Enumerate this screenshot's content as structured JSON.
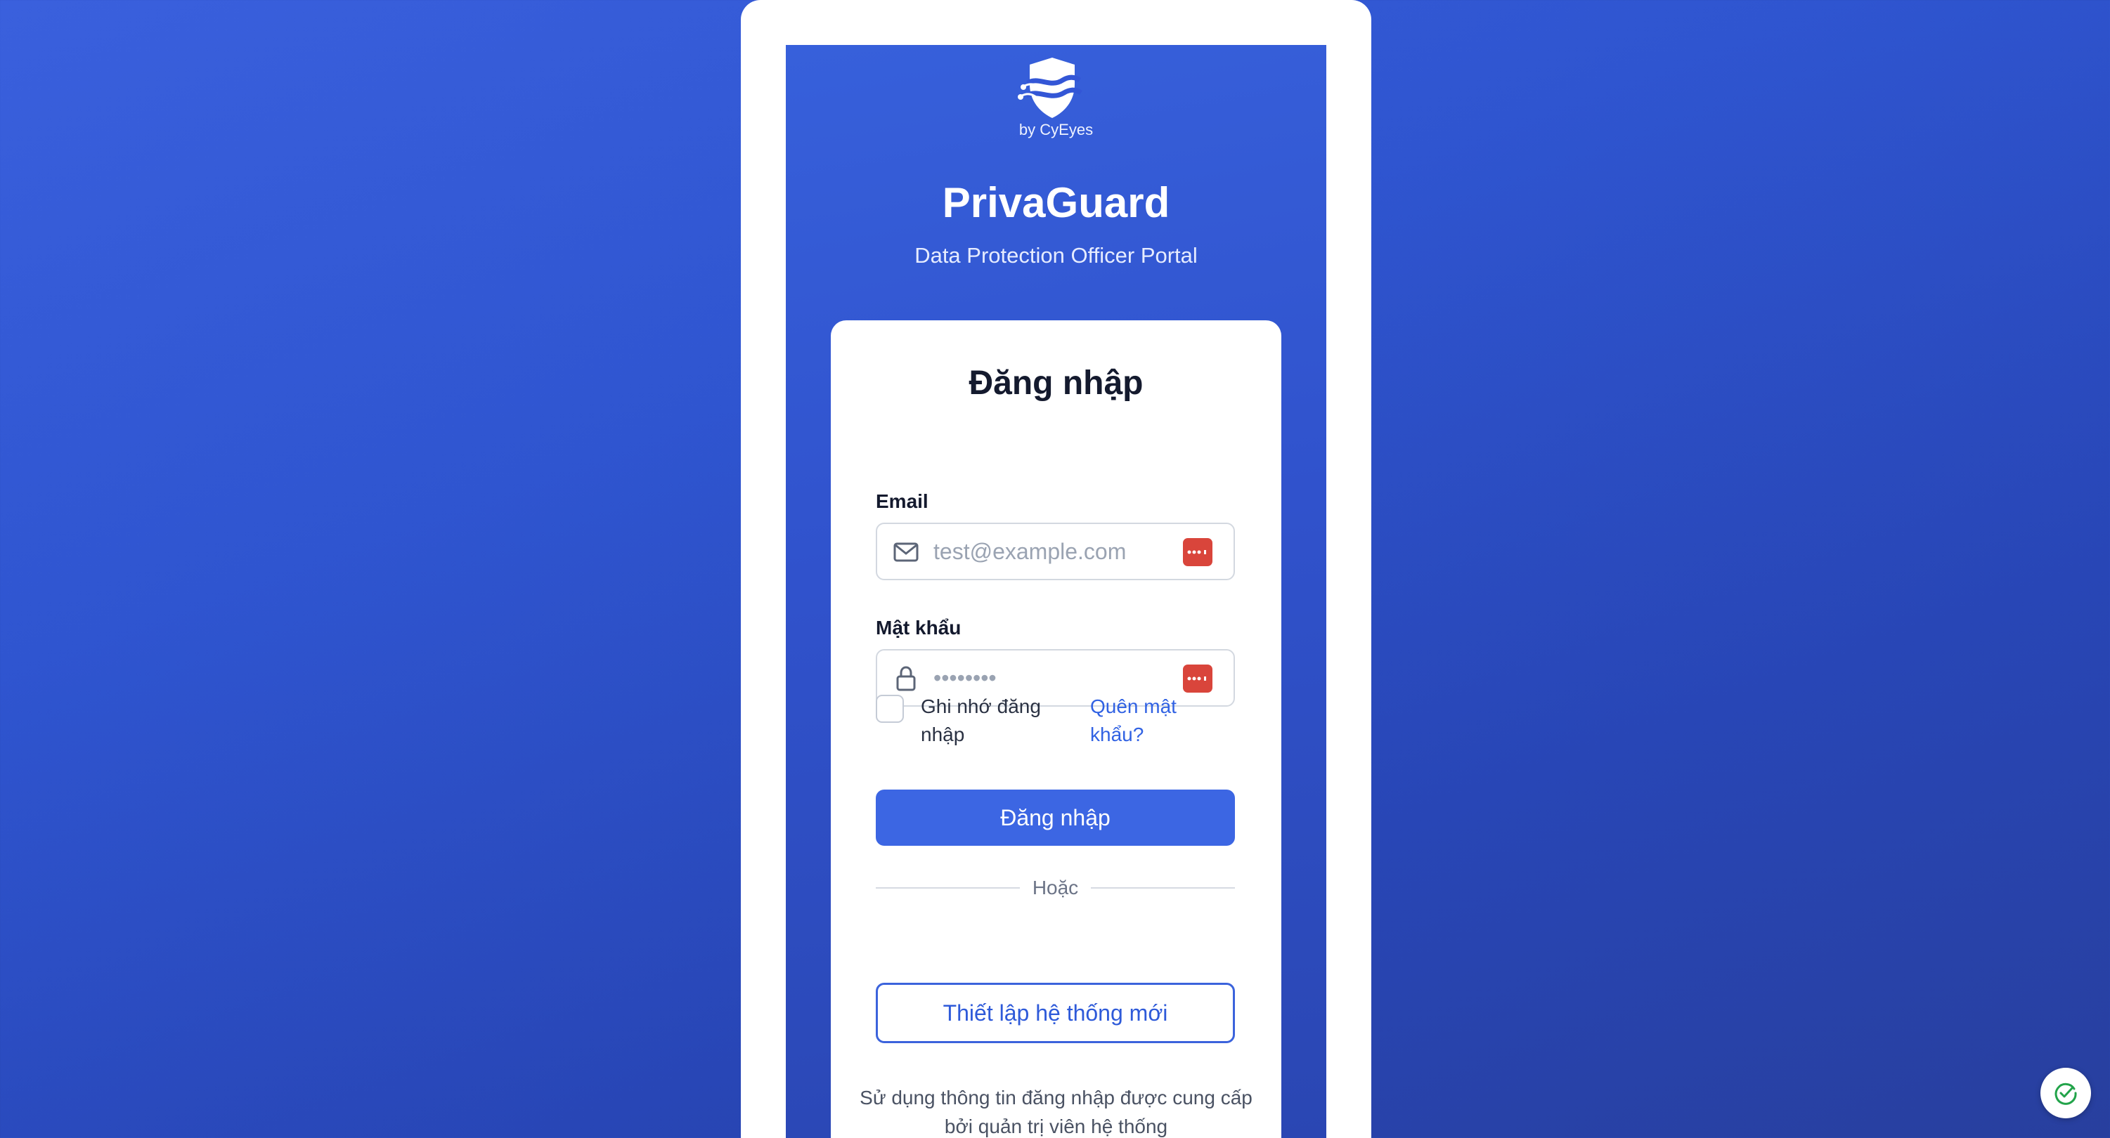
{
  "brand": {
    "logo_icon": "shield-wave-logo",
    "byline": "by CyEyes",
    "app_name": "PrivaGuard",
    "subtitle": "Data Protection Officer Portal"
  },
  "login_card": {
    "title": "Đăng nhập",
    "email": {
      "label": "Email",
      "placeholder": "test@example.com",
      "value": "",
      "icon": "mail-icon"
    },
    "password": {
      "label": "Mật khẩu",
      "placeholder": "••••••••",
      "value": "",
      "icon": "lock-icon"
    },
    "password_manager_icon": "password-manager-icon",
    "remember_me": {
      "label": "Ghi nhớ đăng nhập",
      "checked": false
    },
    "forgot_password": "Quên mật khẩu?",
    "submit_label": "Đăng nhập",
    "divider_text": "Hoặc",
    "setup_label": "Thiết lập hệ thống mới",
    "footer_note": "Sử dụng thông tin đăng nhập được cung cấp bởi quản trị viên hệ thống"
  },
  "status_badge": {
    "icon": "check-circle-icon"
  },
  "colors": {
    "background": "#2f55d0",
    "primary": "#3c66e3",
    "link": "#3162e3",
    "password_manager": "#d9453b",
    "status": "#22a34a"
  }
}
